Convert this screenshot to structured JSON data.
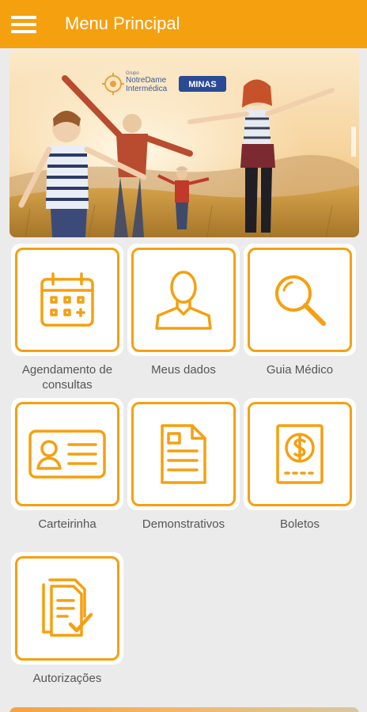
{
  "header": {
    "title": "Menu Principal"
  },
  "banner": {
    "brand_small": "Grupo",
    "brand_line1": "NotreDame",
    "brand_line2": "Intermédica",
    "region": "MINAS"
  },
  "tiles": [
    {
      "label": "Agendamento de consultas",
      "icon": "calendar-icon"
    },
    {
      "label": "Meus dados",
      "icon": "user-icon"
    },
    {
      "label": "Guia Médico",
      "icon": "search-icon"
    },
    {
      "label": "Carteirinha",
      "icon": "id-card-icon"
    },
    {
      "label": "Demonstrativos",
      "icon": "document-icon"
    },
    {
      "label": "Boletos",
      "icon": "invoice-icon"
    },
    {
      "label": "Autorizações",
      "icon": "authorization-icon"
    }
  ],
  "colors": {
    "accent": "#f5a00f",
    "background": "#ebebeb",
    "label": "#555555"
  }
}
